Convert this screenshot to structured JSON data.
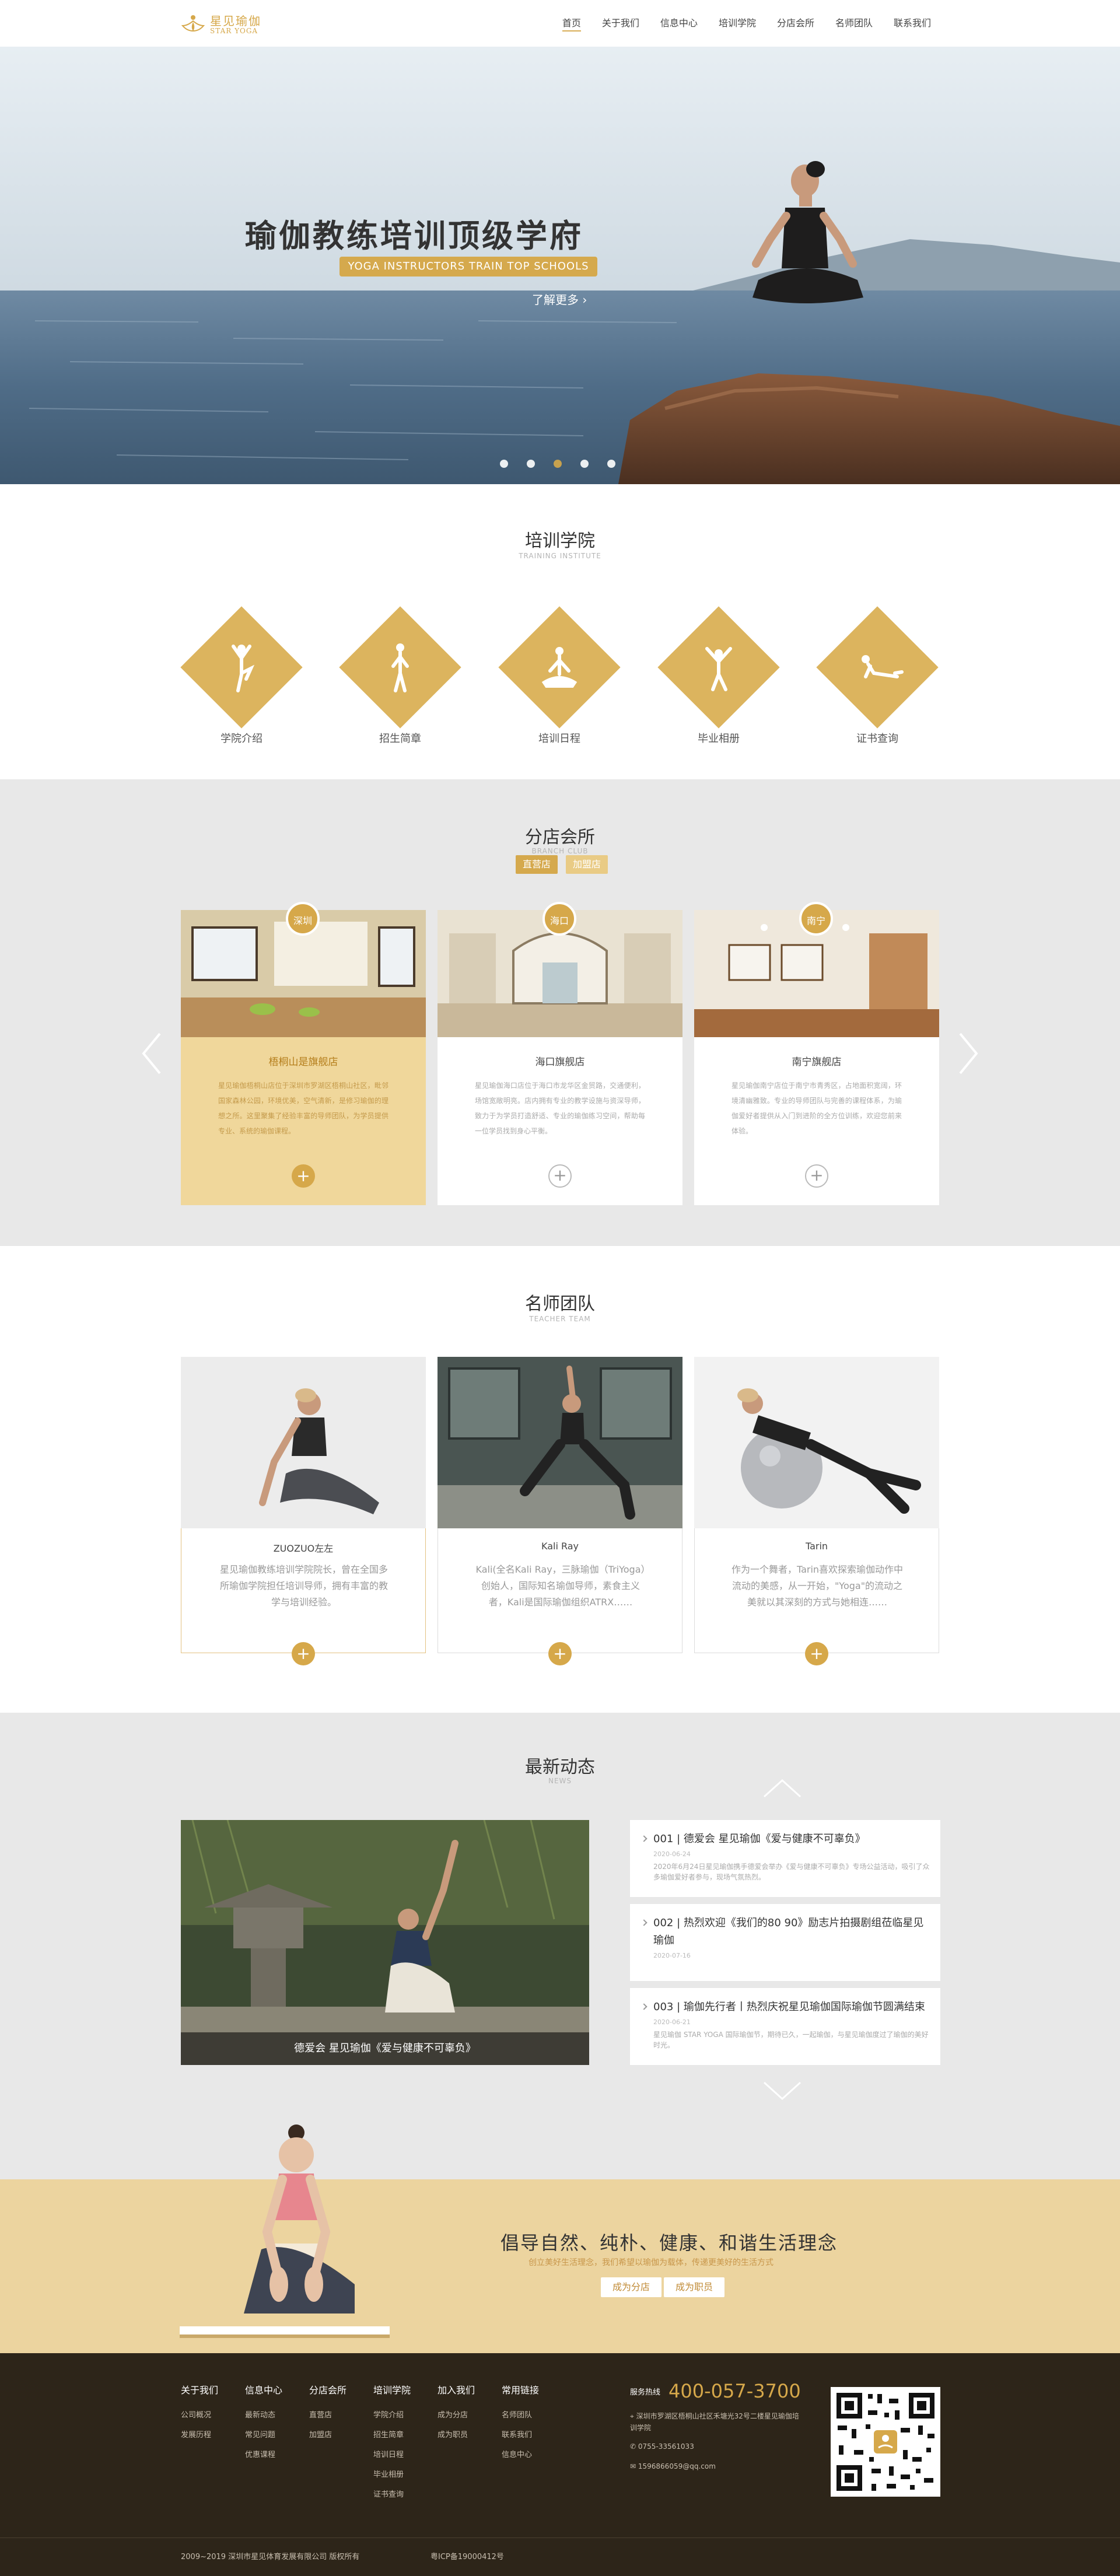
{
  "brand": {
    "name_cn": "星见瑜伽",
    "name_en": "STAR YOGA",
    "accent": "#d6a84a"
  },
  "nav": [
    "首页",
    "关于我们",
    "信息中心",
    "培训学院",
    "分店会所",
    "名师团队",
    "联系我们"
  ],
  "banner": {
    "title": "瑜伽教练培训顶级学府",
    "subtitle": "YOGA INSTRUCTORS TRAIN TOP SCHOOLS",
    "more": "了解更多",
    "active_slide": 3,
    "slide_count": 5
  },
  "training": {
    "title": "培训学院",
    "sub": "TRAINING INSTITUTE",
    "items": [
      "学院介绍",
      "招生简章",
      "培训日程",
      "毕业相册",
      "证书查询"
    ]
  },
  "stores": {
    "title": "分店会所",
    "sub": "BRANCH CLUB",
    "tabs": [
      "直营店",
      "加盟店"
    ],
    "cards": [
      {
        "city": "深圳",
        "name": "梧桐山是旗舰店",
        "desc": "星见瑜伽梧桐山店位于深圳市罗湖区梧桐山社区，毗邻国家森林公园，环境优美，空气清新，是修习瑜伽的理想之所。这里聚集了经验丰富的导师团队，为学员提供专业、系统的瑜伽课程。"
      },
      {
        "city": "海口",
        "name": "海口旗舰店",
        "desc": "星见瑜伽海口店位于海口市龙华区金贸路，交通便利，场馆宽敞明亮。店内拥有专业的教学设施与资深导师，致力于为学员打造舒适、专业的瑜伽练习空间，帮助每一位学员找到身心平衡。"
      },
      {
        "city": "南宁",
        "name": "南宁旗舰店",
        "desc": "星见瑜伽南宁店位于南宁市青秀区，占地面积宽阔，环境清幽雅致。专业的导师团队与完善的课程体系，为瑜伽爱好者提供从入门到进阶的全方位训练，欢迎您前来体验。"
      }
    ]
  },
  "teachers": {
    "title": "名师团队",
    "sub": "TEACHER TEAM",
    "cards": [
      {
        "name": "ZUOZUO左左",
        "desc": "星见瑜伽教练培训学院院长，曾在全国多所瑜伽学院担任培训导师，拥有丰富的教学与培训经验。"
      },
      {
        "name": "Kali Ray",
        "desc": "Kali(全名Kali Ray，三脉瑜伽（TriYoga）创始人，国际知名瑜伽导师，素食主义者，Kali是国际瑜伽组织ATRX……"
      },
      {
        "name": "Tarin",
        "desc": "作为一个舞者，Tarin喜欢探索瑜伽动作中流动的美感，从一开始，\"Yoga\"的流动之美就以其深刻的方式与她相连……"
      }
    ]
  },
  "news": {
    "title": "最新动态",
    "sub": "NEWS",
    "feature_caption": "德爱会 星见瑜伽《爱与健康不可辜负》",
    "items": [
      {
        "title": "001 | 德爱会 星见瑜伽《爱与健康不可辜负》",
        "date": "2020-06-24",
        "desc": "2020年6月24日星见瑜伽携手德爱会举办《爱与健康不可辜负》专场公益活动，吸引了众多瑜伽爱好者参与，现场气氛热烈。"
      },
      {
        "title": "002 | 热烈欢迎《我们的80 90》励志片拍摄剧组莅临星见瑜伽",
        "date": "2020-07-16",
        "desc": ""
      },
      {
        "title": "003 | 瑜伽先行者丨热烈庆祝星见瑜伽国际瑜伽节圆满结束",
        "date": "2020-06-21",
        "desc": "星见瑜伽 STAR YOGA 国际瑜伽节，期待已久，一起瑜伽，与星见瑜伽度过了瑜伽的美好时光。"
      }
    ]
  },
  "cta": {
    "title": "倡导自然、纯朴、健康、和谐生活理念",
    "sub": "创立美好生活理念，我们希望以瑜伽为载体，传递更美好的生活方式",
    "btn1": "成为分店",
    "btn2": "成为职员"
  },
  "footer": {
    "cols": [
      {
        "h": "关于我们",
        "links": [
          "公司概况",
          "发展历程"
        ]
      },
      {
        "h": "信息中心",
        "links": [
          "最新动态",
          "常见问题",
          "优惠课程"
        ]
      },
      {
        "h": "分店会所",
        "links": [
          "直营店",
          "加盟店"
        ]
      },
      {
        "h": "培训学院",
        "links": [
          "学院介绍",
          "招生简章",
          "培训日程",
          "毕业相册",
          "证书查询"
        ]
      },
      {
        "h": "加入我们",
        "links": [
          "成为分店",
          "成为职员"
        ]
      },
      {
        "h": "常用链接",
        "links": [
          "名师团队",
          "联系我们",
          "信息中心"
        ]
      }
    ],
    "hotline_label": "服务热线",
    "hotline": "400-057-3700",
    "address": "深圳市罗湖区梧桐山社区禾塘光32号二楼星见瑜伽培训学院",
    "phone": "0755-33561033",
    "email": "1596866059@qq.com",
    "copyright": "2009~2019 深圳市星见体育发展有限公司 版权所有",
    "icp": "粤ICP备19000412号"
  }
}
